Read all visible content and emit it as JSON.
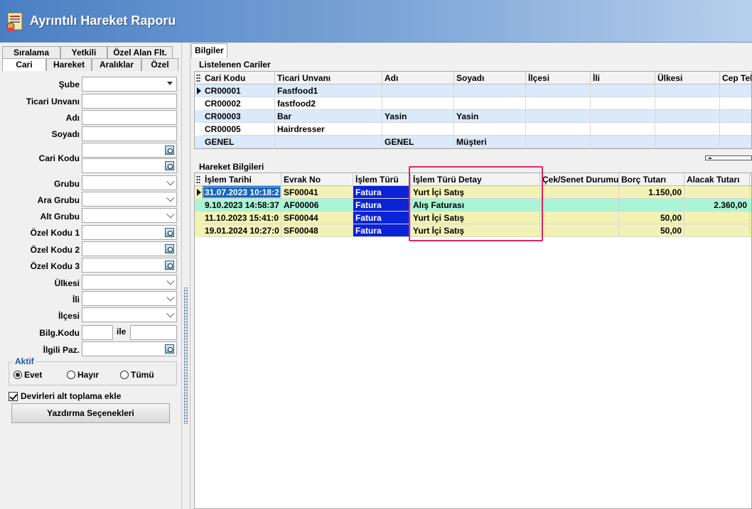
{
  "window": {
    "title": "Ayrıntılı Hareket Raporu"
  },
  "left_tabs": {
    "row1": [
      "Sıralama",
      "Yetkili",
      "Özel Alan Flt."
    ],
    "row2": [
      "Cari",
      "Hareket",
      "Aralıklar",
      "Özel"
    ],
    "active": "Cari"
  },
  "form": {
    "sube": "Şube",
    "ticari_unvani": "Ticari Unvanı",
    "adi": "Adı",
    "soyadi": "Soyadı",
    "cari_kodu": "Cari Kodu",
    "grubu": "Grubu",
    "ara_grubu": "Ara Grubu",
    "alt_grubu": "Alt Grubu",
    "ozel_kodu_1": "Özel Kodu 1",
    "ozel_kodu_2": "Özel Kodu 2",
    "ozel_kodu_3": "Özel Kodu 3",
    "ulkesi": "Ülkesi",
    "ili": "İli",
    "ilcesi": "İlçesi",
    "bilg_kodu": "Bilg.Kodu",
    "ile": "ile",
    "ilgili_paz": "İlgili Paz."
  },
  "aktif": {
    "title": "Aktif",
    "options": [
      "Evet",
      "Hayır",
      "Tümü"
    ],
    "selected": "Evet"
  },
  "devir_checkbox": {
    "label": "Devirleri alt toplama ekle",
    "checked": true
  },
  "print_button": "Yazdırma Seçenekleri",
  "right_tab": "Bilgiler",
  "cariler": {
    "title": "Listelenen Cariler",
    "headers": [
      "Cari Kodu",
      "Ticari Unvanı",
      "Adı",
      "Soyadı",
      "İlçesi",
      "İli",
      "Ülkesi",
      "Cep Tel"
    ],
    "rows": [
      [
        "CR00001",
        "Fastfood1",
        "",
        "",
        "",
        "",
        "",
        ""
      ],
      [
        "CR00002",
        "fastfood2",
        "",
        "",
        "",
        "",
        "",
        ""
      ],
      [
        "CR00003",
        "Bar",
        "Yasin",
        "Yasin",
        "",
        "",
        "",
        ""
      ],
      [
        "CR00005",
        "Hairdresser",
        "",
        "",
        "",
        "",
        "",
        ""
      ],
      [
        "GENEL",
        "",
        "GENEL",
        "Müşteri",
        "",
        "",
        "",
        ""
      ]
    ]
  },
  "hareket": {
    "title": "Hareket Bilgileri",
    "headers": [
      "İşlem Tarihi",
      "Evrak No",
      "İşlem Türü",
      "İşlem Türü Detay",
      "Çek/Senet Durumu",
      "Borç Tutarı",
      "Alacak Tutarı"
    ],
    "rows": [
      [
        "31.07.2023 10:18:2",
        "SF00041",
        "Fatura",
        "Yurt İçi Satış",
        "",
        "1.150,00",
        ""
      ],
      [
        "9.10.2023 14:58:37",
        "AF00006",
        "Fatura",
        "Alış Faturası",
        "",
        "",
        "2.360,00"
      ],
      [
        "11.10.2023 15:41:0",
        "SF00044",
        "Fatura",
        "Yurt İçi Satış",
        "",
        "50,00",
        ""
      ],
      [
        "19.01.2024 10:27:0",
        "SF00048",
        "Fatura",
        "Yurt İçi Satış",
        "",
        "50,00",
        ""
      ]
    ]
  },
  "colors": {
    "row_yellow": "#f2f2b6",
    "row_green": "#a9f5d5",
    "row_blue_light": "#dbeafa",
    "fatura_bg": "#0a23d6",
    "highlight_border": "#e0245e"
  }
}
